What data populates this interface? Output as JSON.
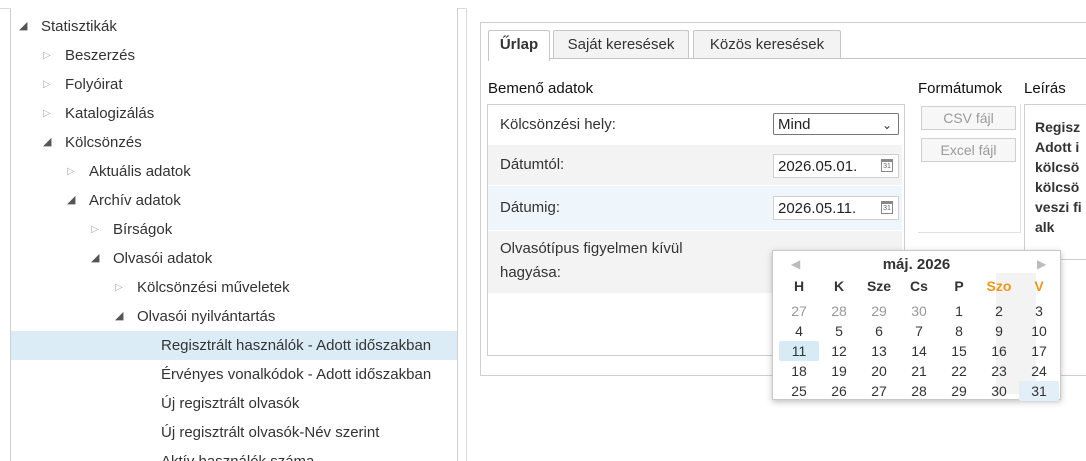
{
  "tree": [
    {
      "label": "Statisztikák",
      "open": true,
      "depth": 0
    },
    {
      "label": "Beszerzés",
      "open": false,
      "depth": 1
    },
    {
      "label": "Folyóirat",
      "open": false,
      "depth": 1
    },
    {
      "label": "Katalogizálás",
      "open": false,
      "depth": 1
    },
    {
      "label": "Kölcsönzés",
      "open": true,
      "depth": 1
    },
    {
      "label": "Aktuális adatok",
      "open": false,
      "depth": 2
    },
    {
      "label": "Archív adatok",
      "open": true,
      "depth": 2
    },
    {
      "label": "Bírságok",
      "open": false,
      "depth": 3
    },
    {
      "label": "Olvasói adatok",
      "open": true,
      "depth": 3
    },
    {
      "label": "Kölcsönzési műveletek",
      "open": false,
      "depth": 4
    },
    {
      "label": "Olvasói nyilvántartás",
      "open": true,
      "depth": 4
    },
    {
      "label": "Regisztrált használók - Adott időszakban",
      "leaf": true,
      "selected": true,
      "depth": 5
    },
    {
      "label": "Érvényes vonalkódok - Adott időszakban",
      "leaf": true,
      "depth": 5
    },
    {
      "label": "Új regisztrált olvasók",
      "leaf": true,
      "depth": 5
    },
    {
      "label": "Új regisztrált olvasók-Név szerint",
      "leaf": true,
      "depth": 5
    },
    {
      "label": "Aktív használók száma",
      "leaf": true,
      "depth": 5
    }
  ],
  "tabs": [
    "Űrlap",
    "Saját keresések",
    "Közös keresések"
  ],
  "sections": {
    "input": "Bemenő adatok",
    "formats": "Formátumok",
    "description": "Leírás"
  },
  "form": {
    "location_label": "Kölcsönzési hely:",
    "location_value": "Mind",
    "date_from_label": "Dátumtól:",
    "date_from_value": "2026.05.01.",
    "date_to_label": "Dátumig:",
    "date_to_value": "2026.05.11.",
    "ignore_label_1": "Olvasótípus figyelmen kívül",
    "ignore_label_2": "hagyása:"
  },
  "formats": {
    "csv": "CSV fájl",
    "excel": "Excel fájl"
  },
  "description_lines": [
    "Regisz",
    "Adott i",
    "kölcsö",
    "kölcsö",
    "veszi fi",
    "alk"
  ],
  "calendar": {
    "month_label": "máj. 2026",
    "weekdays": [
      "H",
      "K",
      "Sze",
      "Cs",
      "P",
      "Szo",
      "V"
    ],
    "weeks": [
      [
        "27",
        "28",
        "29",
        "30",
        "1",
        "2",
        "3"
      ],
      [
        "4",
        "5",
        "6",
        "7",
        "8",
        "9",
        "10"
      ],
      [
        "11",
        "12",
        "13",
        "14",
        "15",
        "16",
        "17"
      ],
      [
        "18",
        "19",
        "20",
        "21",
        "22",
        "23",
        "24"
      ],
      [
        "25",
        "26",
        "27",
        "28",
        "29",
        "30",
        "31"
      ]
    ],
    "other_month_first_row_count": 4,
    "today": "11",
    "selected": "31",
    "weekend_color": "#f0941c"
  },
  "colors": {
    "selection": "#dcecf7",
    "border": "#cfcfcf"
  }
}
